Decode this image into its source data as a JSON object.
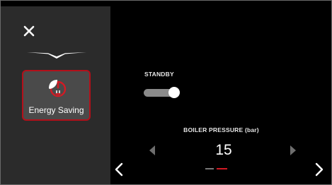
{
  "sidebar": {
    "close_icon": "close-icon",
    "mode_tile": {
      "label": "Energy Saving",
      "icon": "leaf-power-icon",
      "accent": "#b3101a"
    }
  },
  "standby": {
    "label": "STANDBY",
    "state": "on"
  },
  "pressure": {
    "label": "BOILER PRESSURE (bar)",
    "value": "15"
  },
  "pagination": {
    "total": 2,
    "active": 2
  },
  "colors": {
    "background": "#000000",
    "sidebar": "#2b2b2b",
    "accent": "#d21a24"
  }
}
